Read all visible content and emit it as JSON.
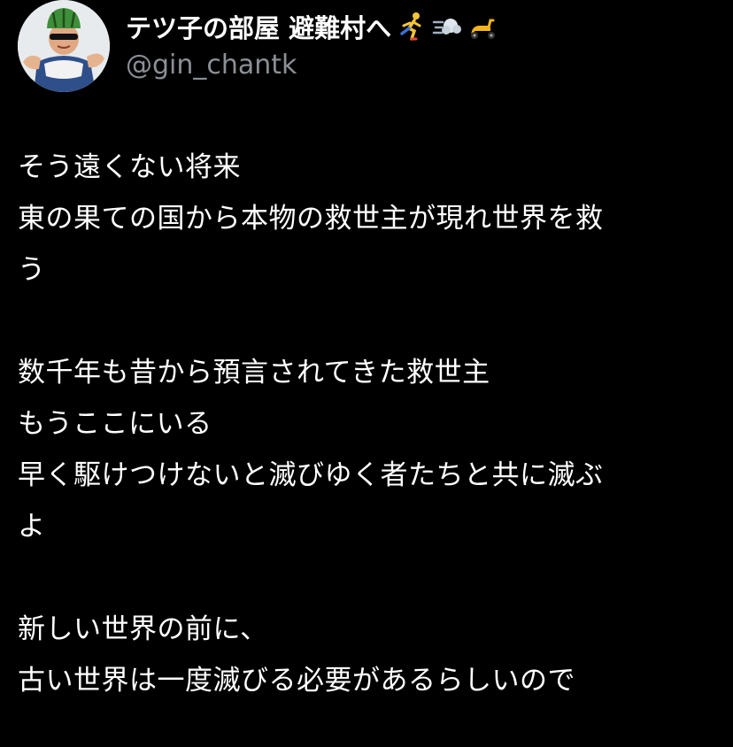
{
  "profile": {
    "display_name": "テツ子の部屋 避難村へ",
    "name_emojis": [
      "running-person-emoji",
      "dash-emoji",
      "scooter-emoji"
    ],
    "handle": "@gin_chantk"
  },
  "tweet": {
    "lines": [
      "そう遠くない将来",
      "東の果ての国から本物の救世主が現れ世界を救",
      "う",
      "",
      "数千年も昔から預言されてきた救世主",
      "もうここにいる",
      "早く駆けつけないと滅びゆく者たちと共に滅ぶ",
      "よ",
      "",
      "新しい世界の前に、",
      "古い世界は一度滅びる必要があるらしいので"
    ]
  },
  "colors": {
    "background": "#000000",
    "text": "#ffffff",
    "handle": "#8b8f96"
  }
}
